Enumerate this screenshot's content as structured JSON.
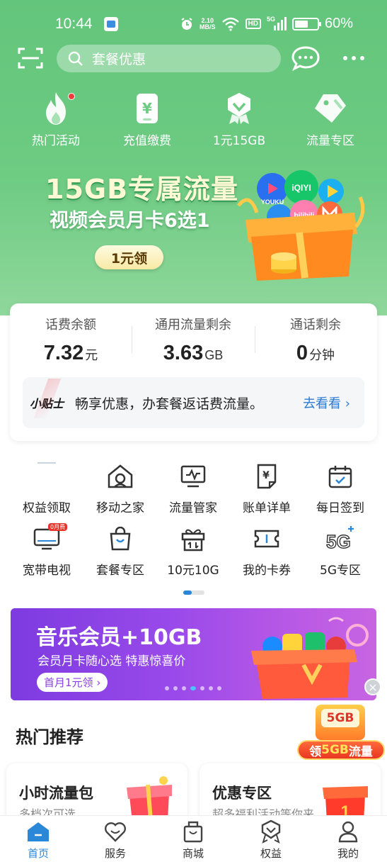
{
  "status_bar": {
    "time": "10:44",
    "speed_top": "2.10",
    "speed_bottom": "MB/S",
    "hd": "HD",
    "network": "5G",
    "battery": "60%",
    "battery_level": 0.6
  },
  "header": {
    "search_placeholder": "套餐优惠"
  },
  "quick_actions": [
    {
      "label": "热门活动",
      "icon": "flame-icon",
      "has_dot": true
    },
    {
      "label": "充值缴费",
      "icon": "recharge-icon",
      "has_dot": false
    },
    {
      "label": "1元15GB",
      "icon": "badge-icon",
      "has_dot": false
    },
    {
      "label": "流量专区",
      "icon": "tag-icon",
      "has_dot": false
    }
  ],
  "hero_banner": {
    "title": "15GB专属流量",
    "subtitle": "视频会员月卡6选1",
    "button": "1元领",
    "brand_labels": [
      "YOUKU",
      "iQIYI",
      "bilibili"
    ]
  },
  "balance": {
    "items": [
      {
        "label": "话费余额",
        "value": "7.32",
        "unit": "元"
      },
      {
        "label": "通用流量剩余",
        "value": "3.63",
        "unit": "GB"
      },
      {
        "label": "通话剩余",
        "value": "0",
        "unit": "分钟"
      }
    ],
    "tip_logo": "小贴士",
    "tip_text": "畅享优惠，办套餐返话费流量。",
    "tip_link": "去看看"
  },
  "services": [
    {
      "label": "权益领取",
      "icon": "gift-rights-icon"
    },
    {
      "label": "移动之家",
      "icon": "home-icon"
    },
    {
      "label": "流量管家",
      "icon": "monitor-icon"
    },
    {
      "label": "账单详单",
      "icon": "bill-icon"
    },
    {
      "label": "每日签到",
      "icon": "calendar-check-icon"
    },
    {
      "label": "宽带电视",
      "icon": "tv-icon",
      "badge": "0月费"
    },
    {
      "label": "套餐专区",
      "icon": "shopping-bag-icon"
    },
    {
      "label": "10元10G",
      "icon": "gift-icon"
    },
    {
      "label": "我的卡券",
      "icon": "ticket-icon"
    },
    {
      "label": "5G专区",
      "icon": "5g-icon"
    }
  ],
  "pager": {
    "pages": 2,
    "active": 0
  },
  "music_banner": {
    "title": "音乐会员+10GB",
    "subtitle": "会员月卡随心选 特惠惊喜价",
    "button": "首月1元领",
    "dot_count": 7,
    "active_dot": 3
  },
  "hot_section": {
    "title": "热门推荐",
    "float_badge": "5GB",
    "float_label_prefix": "领",
    "float_label_highlight": "5GB",
    "float_label_suffix": "流量",
    "cards": [
      {
        "title": "小时流量包",
        "subtitle": "多档次可选"
      },
      {
        "title": "优惠专区",
        "subtitle": "超多福利活动等你来"
      }
    ]
  },
  "tabbar": {
    "active": 0,
    "tabs": [
      {
        "label": "首页",
        "icon": "home-tab-icon"
      },
      {
        "label": "服务",
        "icon": "heart-icon"
      },
      {
        "label": "商城",
        "icon": "bag-icon"
      },
      {
        "label": "权益",
        "icon": "medal-icon"
      },
      {
        "label": "我的",
        "icon": "person-icon"
      }
    ]
  },
  "colors": {
    "hero_green": "#6dcb82",
    "accent_blue": "#2b87d8",
    "music_purple": "#9a4aea"
  }
}
